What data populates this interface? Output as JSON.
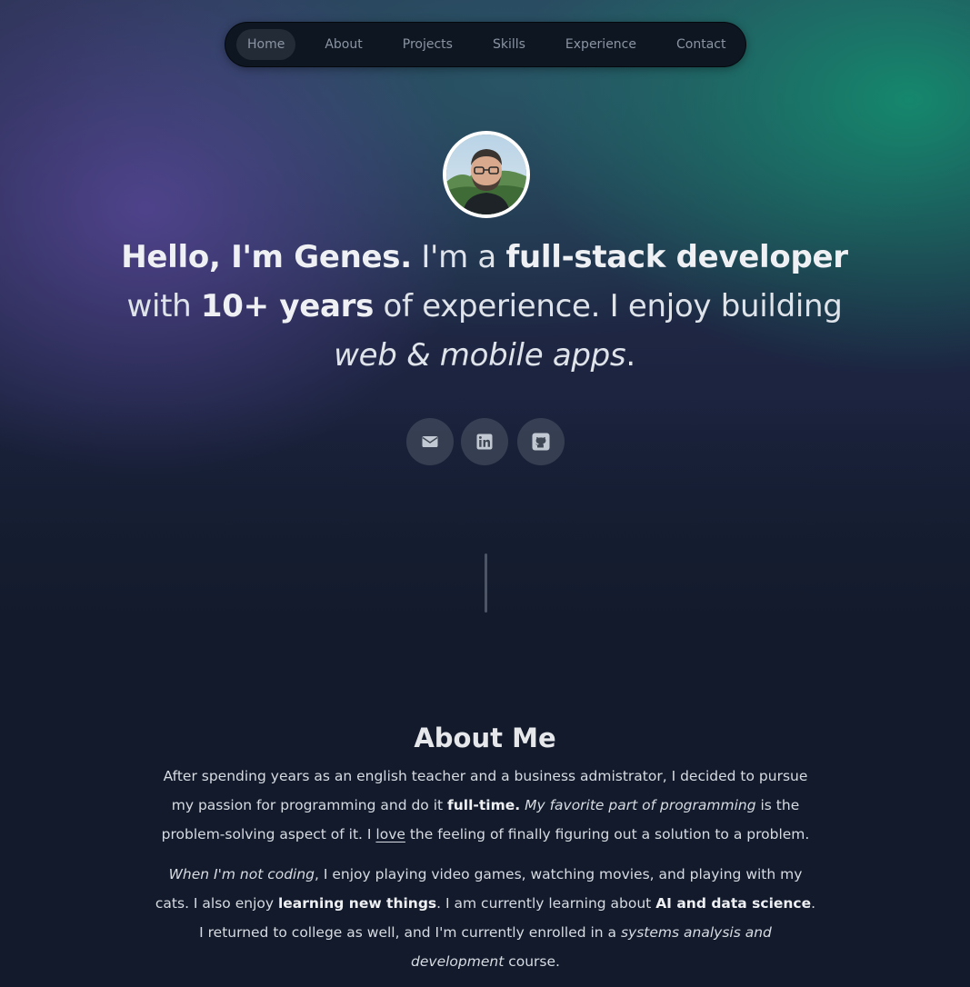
{
  "nav": {
    "items": [
      {
        "label": "Home",
        "active": true
      },
      {
        "label": "About",
        "active": false
      },
      {
        "label": "Projects",
        "active": false
      },
      {
        "label": "Skills",
        "active": false
      },
      {
        "label": "Experience",
        "active": false
      },
      {
        "label": "Contact",
        "active": false
      }
    ]
  },
  "hero": {
    "intro_bold": "Hello, I'm Genes.",
    "t1": " I'm a ",
    "role_bold": "full-stack developer",
    "t2": " with ",
    "years_bold": "10+ years",
    "t3": " of experience. I enjoy building ",
    "apps_italic": "web & mobile apps",
    "t4": "."
  },
  "socials": [
    {
      "icon": "envelope-icon",
      "label": "email"
    },
    {
      "icon": "linkedin-icon",
      "label": "linkedin"
    },
    {
      "icon": "github-icon",
      "label": "github"
    }
  ],
  "about": {
    "title": "About Me",
    "p1": {
      "a": "After spending years as an english teacher and a business admistrator, I decided to pursue my passion for programming and do it ",
      "b_bold": "full-time.",
      "c": " ",
      "d_italic": "My favorite part of programming",
      "e": " is the problem-solving aspect of it. I ",
      "f_underline": "love",
      "g": " the feeling of finally figuring out a solution to a problem."
    },
    "p2": {
      "a_italic": "When I'm not coding",
      "b": ", I enjoy playing video games, watching movies, and playing with my cats. I also enjoy ",
      "c_bold": "learning new things",
      "d": ". I am currently learning about ",
      "e_bold": "AI and data science",
      "f": ". I returned to college as well, and I'm currently enrolled in a ",
      "g_italic": "systems analysis and development",
      "h": " course."
    }
  },
  "colors": {
    "background": "#121a2b",
    "nav_bg": "#0d1621",
    "accent_green": "#148c6e",
    "accent_purple": "#564696"
  }
}
